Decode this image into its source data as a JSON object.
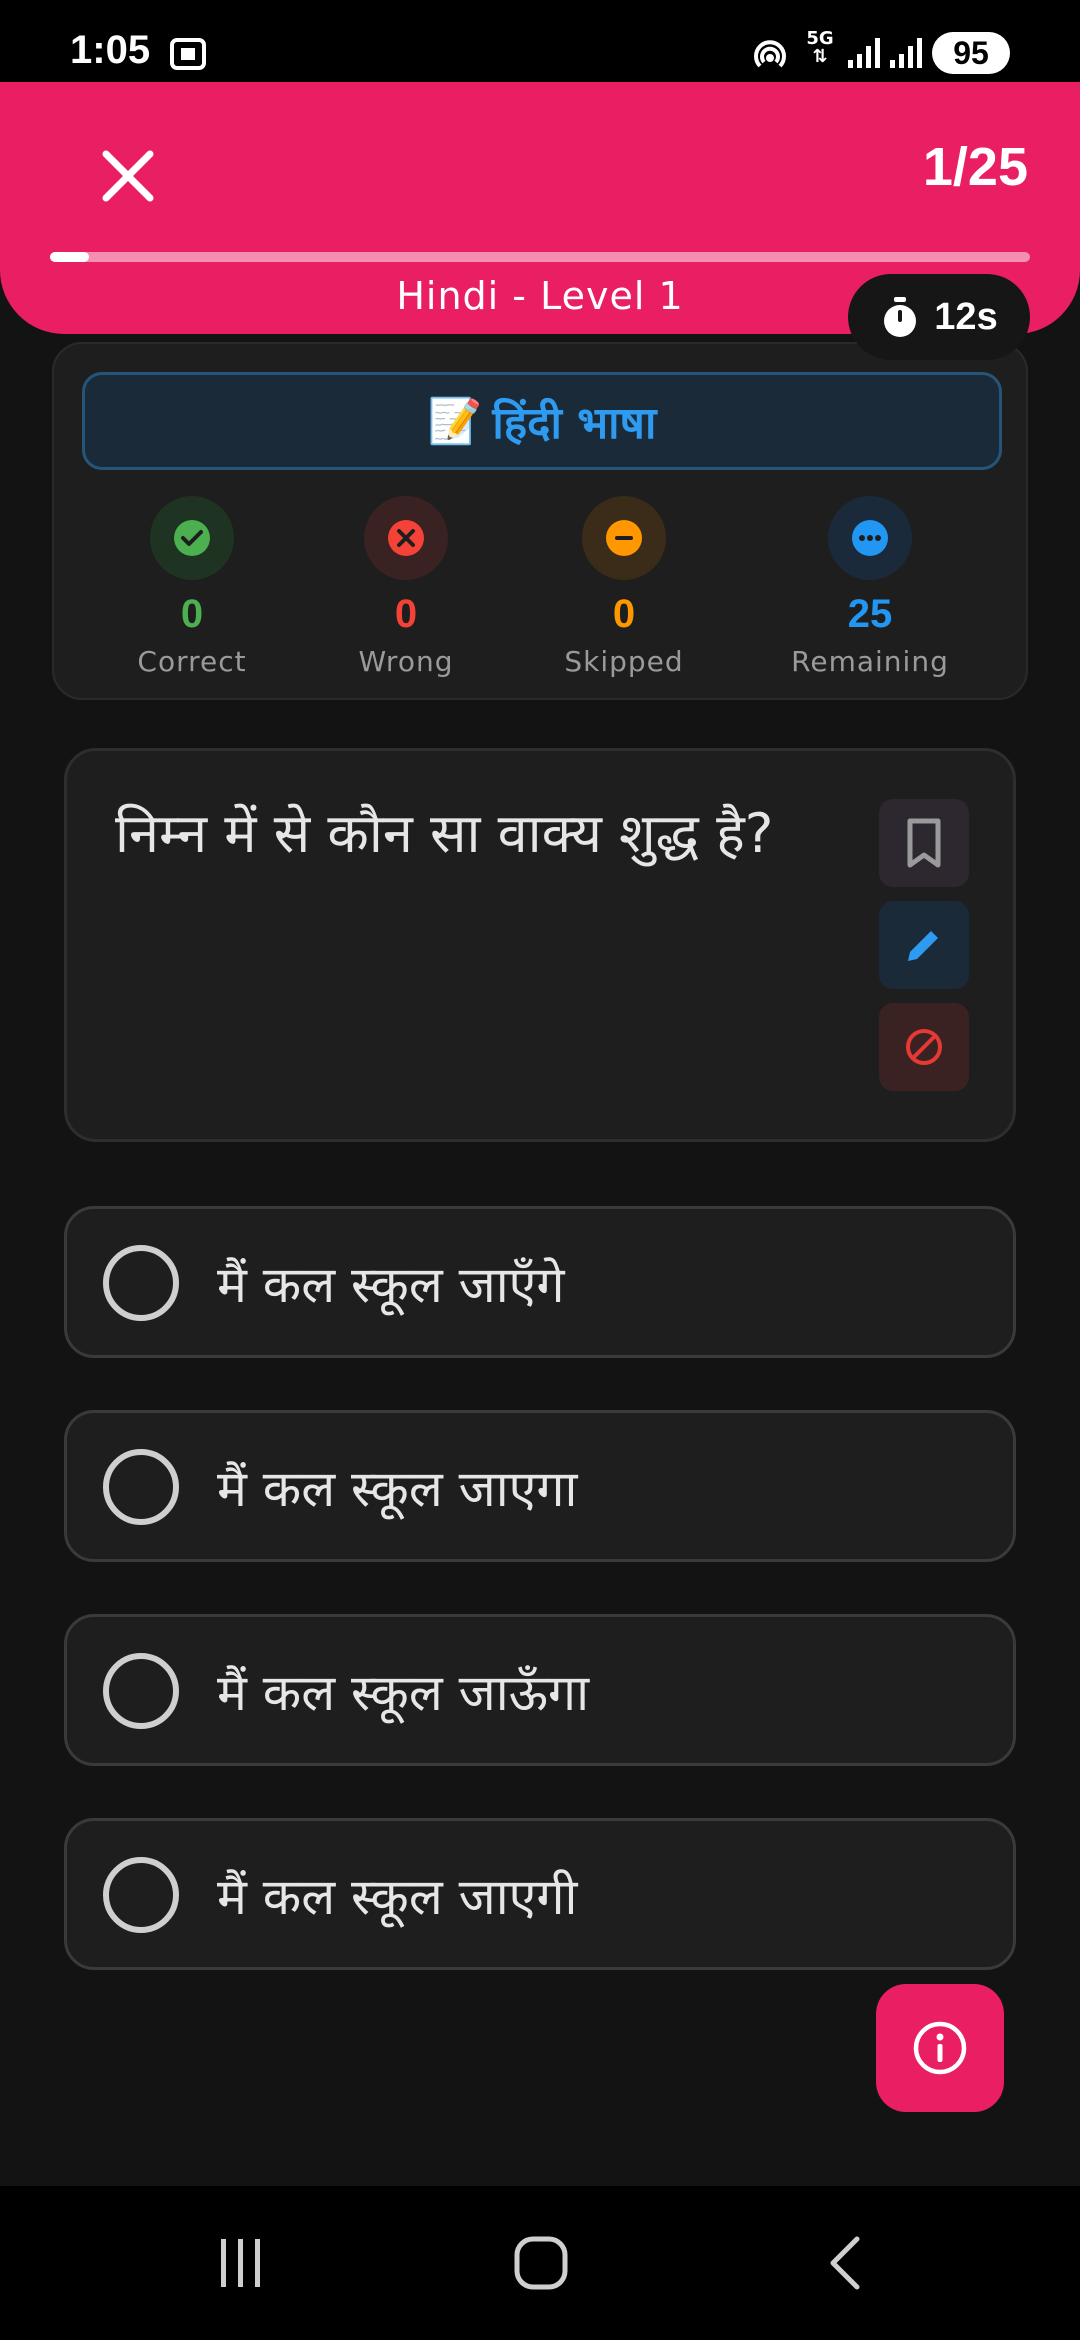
{
  "status_bar": {
    "time": "1:05",
    "battery": "95",
    "network": "5G"
  },
  "header": {
    "progress_text": "1/25",
    "progress_fraction": 0.04,
    "title": "Hindi - Level 1",
    "timer": "12s"
  },
  "subject": {
    "emoji": "📝",
    "label": "हिंदी भाषा"
  },
  "stats": [
    {
      "value": "0",
      "label": "Correct",
      "color": "#4caf50",
      "bg": "#1f3323",
      "icon": "check-icon"
    },
    {
      "value": "0",
      "label": "Wrong",
      "color": "#f44336",
      "bg": "#3a2222",
      "icon": "x-icon"
    },
    {
      "value": "0",
      "label": "Skipped",
      "color": "#ff9800",
      "bg": "#3a2c18",
      "icon": "minus-icon"
    },
    {
      "value": "25",
      "label": "Remaining",
      "color": "#2196f3",
      "bg": "#1b2a3a",
      "icon": "more-icon"
    }
  ],
  "question": {
    "text": "निम्न में से कौन सा वाक्य शुद्ध है?"
  },
  "options": [
    {
      "text": "मैं कल स्कूल जाएँगे"
    },
    {
      "text": "मैं कल स्कूल जाएगा"
    },
    {
      "text": "मैं कल स्कूल जाऊँगा"
    },
    {
      "text": "मैं कल स्कूल जाएगी"
    }
  ],
  "colors": {
    "accent": "#e91e63",
    "background": "#131313",
    "card": "#1e1e1e"
  }
}
